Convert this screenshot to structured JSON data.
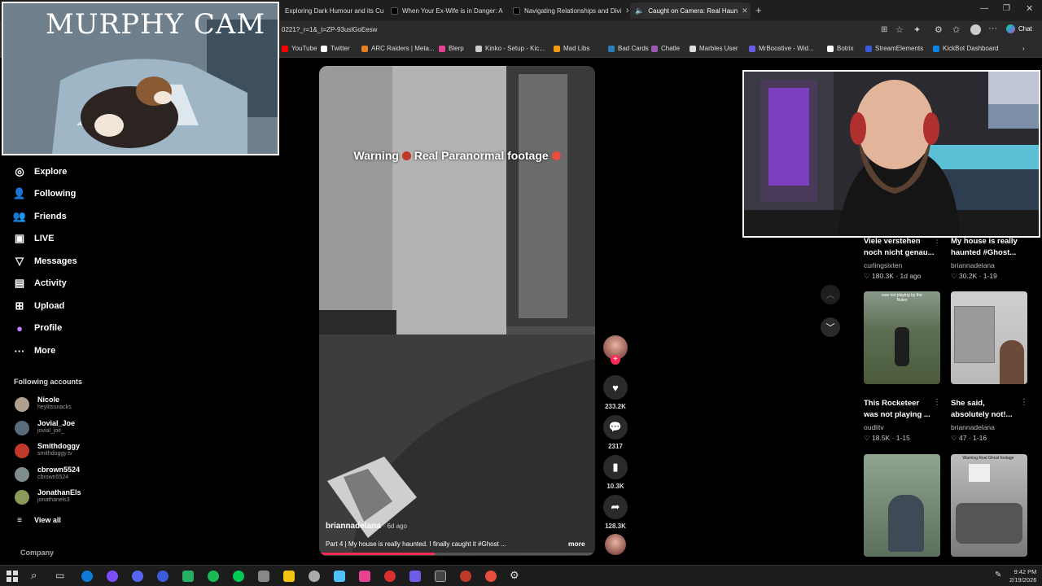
{
  "browser": {
    "tabs": [
      {
        "label": "Exploring Dark Humour and its Cu"
      },
      {
        "label": "When Your Ex-Wife is in Danger: A"
      },
      {
        "label": "Navigating Relationships and Divi"
      },
      {
        "label": "Caught on Camera: Real Haun"
      }
    ],
    "url": "0221?_r=1&_t=ZP-93uslGoEesw",
    "chat_label": "Chat",
    "bookmarks": [
      {
        "label": "YouTube",
        "color": "#ff0000"
      },
      {
        "label": "Twitter",
        "color": "#ffffff"
      },
      {
        "label": "ARC Raiders | Meta...",
        "color": "#e67e22"
      },
      {
        "label": "Blerp",
        "color": "#e84393"
      },
      {
        "label": "Kinko - Setup - Kic...",
        "color": "#cccccc"
      },
      {
        "label": "Mad Libs",
        "color": "#f39c12"
      },
      {
        "label": "Bad Cards",
        "color": "#2980b9"
      },
      {
        "label": "Chatle",
        "color": "#9b59b6"
      },
      {
        "label": "Marbles User",
        "color": "#dddddd"
      },
      {
        "label": "MrBoostive - Wid...",
        "color": "#6c5ce7"
      },
      {
        "label": "Botrix",
        "color": "#ffffff"
      },
      {
        "label": "StreamElements",
        "color": "#3b5bdb"
      },
      {
        "label": "KickBot Dashboard",
        "color": "#0984e3"
      }
    ]
  },
  "overlay": {
    "cam_title": "MURPHY CAM"
  },
  "sidebar": {
    "nav": [
      {
        "label": "Explore",
        "icon": "compass-icon",
        "glyph": "◎"
      },
      {
        "label": "Following",
        "icon": "person-add-icon",
        "glyph": "👤"
      },
      {
        "label": "Friends",
        "icon": "friends-icon",
        "glyph": "👥"
      },
      {
        "label": "LIVE",
        "icon": "live-icon",
        "glyph": "▣"
      },
      {
        "label": "Messages",
        "icon": "messages-icon",
        "glyph": "▽"
      },
      {
        "label": "Activity",
        "icon": "activity-icon",
        "glyph": "▤"
      },
      {
        "label": "Upload",
        "icon": "upload-icon",
        "glyph": "⊞"
      },
      {
        "label": "Profile",
        "icon": "profile-avatar-icon",
        "glyph": "●"
      },
      {
        "label": "More",
        "icon": "more-dots-icon",
        "glyph": "···"
      }
    ],
    "following_title": "Following accounts",
    "accounts": [
      {
        "name": "Nicole",
        "handle": "heylitssnacks",
        "color": "#b0a090"
      },
      {
        "name": "Jovial_Joe",
        "handle": "jovial_joe_",
        "color": "#5a6b7c"
      },
      {
        "name": "Smithdoggy",
        "handle": "smithdoggy.tv",
        "color": "#c0392b"
      },
      {
        "name": "cbrown5524",
        "handle": "cbrown5524",
        "color": "#7f8c8d"
      },
      {
        "name": "JonathanEls",
        "handle": "jonathanels3",
        "color": "#8a9a5b"
      }
    ],
    "view_all": "View all",
    "company": "Company"
  },
  "video": {
    "caption_a": "Warning",
    "caption_b": "Real Paranormal footage",
    "author": "briannadelana",
    "age": "· 6d ago",
    "description": "Part 4 | My house is really haunted. I finally caught it #Ghost ...",
    "more": "more",
    "likes": "233.2K",
    "comments": "2317",
    "saves": "10.3K",
    "shares": "128.3K",
    "progress": 0.42
  },
  "grid": [
    {
      "title": "Viele verstehen noch nicht genau...",
      "user": "curlingsixten",
      "likes": "180.3K",
      "date": "1d ago"
    },
    {
      "title": "My house is really haunted #Ghost...",
      "user": "briannadelana",
      "likes": "30.2K",
      "date": "1-19"
    },
    {
      "title": "This Rocketeer was not playing ...",
      "user": "oudlitv",
      "likes": "18.5K",
      "date": "1-15",
      "thumb_text": "was not playing by the Rules"
    },
    {
      "title": "She said, absolutely not!...",
      "user": "briannadelana",
      "likes": "47",
      "date": "1-16"
    },
    {
      "thumb_text": "Warning Real Ghost footage"
    }
  ],
  "taskbar": {
    "time": "9:42 PM",
    "date": "2/19/2026"
  }
}
